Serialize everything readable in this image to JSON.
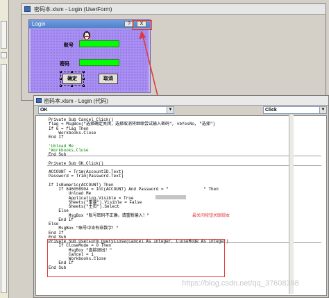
{
  "userform_window": {
    "title": "密码本.xlsm - Login (UserForm)"
  },
  "login_form": {
    "caption": "Login",
    "help_btn": "?",
    "close_btn": "X",
    "account_label": "账号",
    "password_label": "密码",
    "confirm_btn": "确定",
    "cancel_btn": "取消",
    "logo_icon": "qq-penguin-icon"
  },
  "code_window": {
    "title": "密码本.xlsm - Login (代码)",
    "object_dropdown": "OK",
    "proc_dropdown": "Click",
    "lines": [
      {
        "t": "Private Sub Cancel_Click()",
        "c": 0
      },
      {
        "t": "flag = MsgBox(\"选择确定关闭，选择取消将继续尝试输入密码\", vbYesNo, \"选择\")",
        "c": 0
      },
      {
        "t": "If 6 = flag Then",
        "c": 0
      },
      {
        "t": "    Workbooks.Close",
        "c": 0
      },
      {
        "t": "End If",
        "c": 0
      },
      {
        "t": "",
        "c": 0
      },
      {
        "t": "'Unload Me",
        "c": 1
      },
      {
        "t": "'Workbooks.Close",
        "c": 1
      },
      {
        "t": "End Sub",
        "c": 0
      },
      {
        "t": "",
        "c": 0
      },
      {
        "t": "Private Sub OK_Click()",
        "c": 0
      },
      {
        "t": "",
        "c": 0
      },
      {
        "t": "ACCOUNT = Trim(AccountID.Text)",
        "c": 0
      },
      {
        "t": "Password = Trim(Password.Text)",
        "c": 0
      },
      {
        "t": "",
        "c": 0
      },
      {
        "t": "If IsNumeric(ACCOUNT) Then",
        "c": 0
      },
      {
        "t": "    If 846056904 = Int(ACCOUNT) And Password = \"              \" Then",
        "c": 0
      },
      {
        "t": "        Unload Me",
        "c": 0
      },
      {
        "t": "        Application.Visible = True",
        "c": 0
      },
      {
        "t": "        Sheets(\"重要\").Visible = False",
        "c": 0
      },
      {
        "t": "        Sheets(\"主页\").Select",
        "c": 0
      },
      {
        "t": "    Else",
        "c": 0
      },
      {
        "t": "        MsgBox \"账号密码不正确，请重新输入！\"",
        "c": 0
      },
      {
        "t": "    End If",
        "c": 0
      },
      {
        "t": "Else",
        "c": 0
      },
      {
        "t": "    MsgBox \"账号中含有非数字！\"",
        "c": 0
      },
      {
        "t": "End If",
        "c": 0
      },
      {
        "t": "End Sub",
        "c": 0
      },
      {
        "t": "Private Sub UserForm_QueryClose(Cancel As Integer, CloseMode As Integer)",
        "c": 0
      },
      {
        "t": "    If CloseMode = 0 Then",
        "c": 0
      },
      {
        "t": "        MsgBox \"直接退出！\"",
        "c": 0
      },
      {
        "t": "        Cancel = 1",
        "c": 0
      },
      {
        "t": "        Workbooks.Close",
        "c": 0
      },
      {
        "t": "    End If",
        "c": 0
      },
      {
        "t": "End Sub",
        "c": 0
      }
    ]
  },
  "annotation": "最关闭按钮关联脚本",
  "watermark": "https://blog.csdn.net/qq_37608398"
}
